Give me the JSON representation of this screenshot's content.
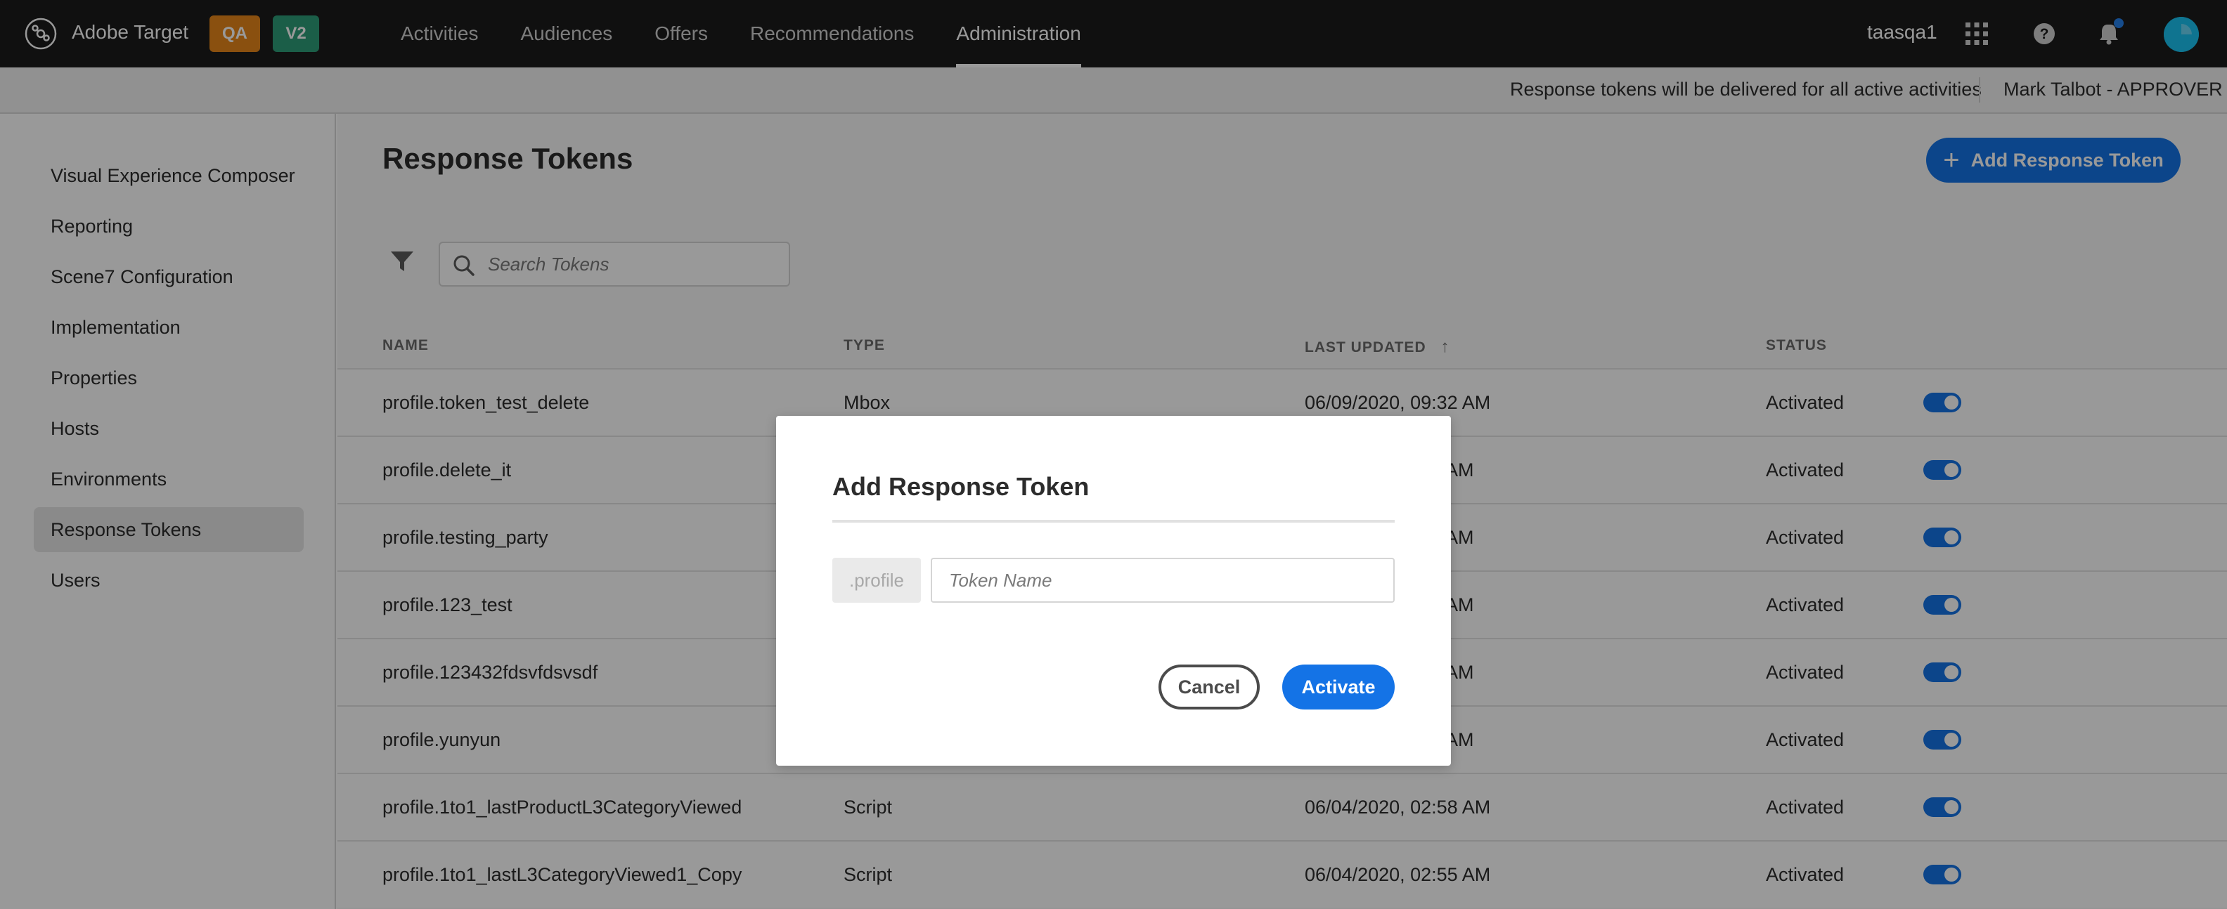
{
  "header": {
    "app_title": "Adobe Target",
    "tags": [
      {
        "label": "QA",
        "color": "#e68619"
      },
      {
        "label": "V2",
        "color": "#2d9d78"
      }
    ],
    "nav": [
      "Activities",
      "Audiences",
      "Offers",
      "Recommendations",
      "Administration"
    ],
    "active_nav": "Administration",
    "username": "taasqa1",
    "icons": [
      "apps-grid-icon",
      "help-icon",
      "notification-bell-icon",
      "user-avatar"
    ]
  },
  "subbar": {
    "message": "Response tokens will be delivered for all active activities",
    "user": "Mark Talbot - APPROVER"
  },
  "sidebar": {
    "items": [
      {
        "label": "Visual Experience Composer"
      },
      {
        "label": "Reporting"
      },
      {
        "label": "Scene7 Configuration"
      },
      {
        "label": "Implementation"
      },
      {
        "label": "Properties"
      },
      {
        "label": "Hosts"
      },
      {
        "label": "Environments"
      },
      {
        "label": "Response Tokens"
      },
      {
        "label": "Users"
      }
    ],
    "active": "Response Tokens"
  },
  "main": {
    "title": "Response Tokens",
    "add_button": "Add Response Token",
    "search_placeholder": "Search Tokens",
    "columns": [
      "NAME",
      "TYPE",
      "LAST UPDATED",
      "STATUS"
    ],
    "sorted_column": "LAST UPDATED",
    "sort_direction": "ascending",
    "rows": [
      {
        "name": "profile.token_test_delete",
        "type": "Mbox",
        "updated": "06/09/2020, 09:32 AM",
        "status": "Activated",
        "enabled": true
      },
      {
        "name": "profile.delete_it",
        "type": "",
        "updated": "AM",
        "status": "Activated",
        "enabled": true
      },
      {
        "name": "profile.testing_party",
        "type": "",
        "updated": "AM",
        "status": "Activated",
        "enabled": true
      },
      {
        "name": "profile.123_test",
        "type": "",
        "updated": "AM",
        "status": "Activated",
        "enabled": true
      },
      {
        "name": "profile.123432fdsvfdsvsdf",
        "type": "",
        "updated": "AM",
        "status": "Activated",
        "enabled": true
      },
      {
        "name": "profile.yunyun",
        "type": "",
        "updated": "AM",
        "status": "Activated",
        "enabled": true
      },
      {
        "name": "profile.1to1_lastProductL3CategoryViewed",
        "type": "Script",
        "updated": "06/04/2020, 02:58 AM",
        "status": "Activated",
        "enabled": true
      },
      {
        "name": "profile.1to1_lastL3CategoryViewed1_Copy",
        "type": "Script",
        "updated": "06/04/2020, 02:55 AM",
        "status": "Activated",
        "enabled": true
      }
    ]
  },
  "modal": {
    "title": "Add Response Token",
    "prefix": ".profile",
    "input_placeholder": "Token Name",
    "input_value": "",
    "cancel_label": "Cancel",
    "activate_label": "Activate"
  },
  "colors": {
    "accent": "#1473e6",
    "topbar": "#1b1b1b",
    "avatar": "#19c1f0",
    "notification_dot": "#2680eb"
  }
}
